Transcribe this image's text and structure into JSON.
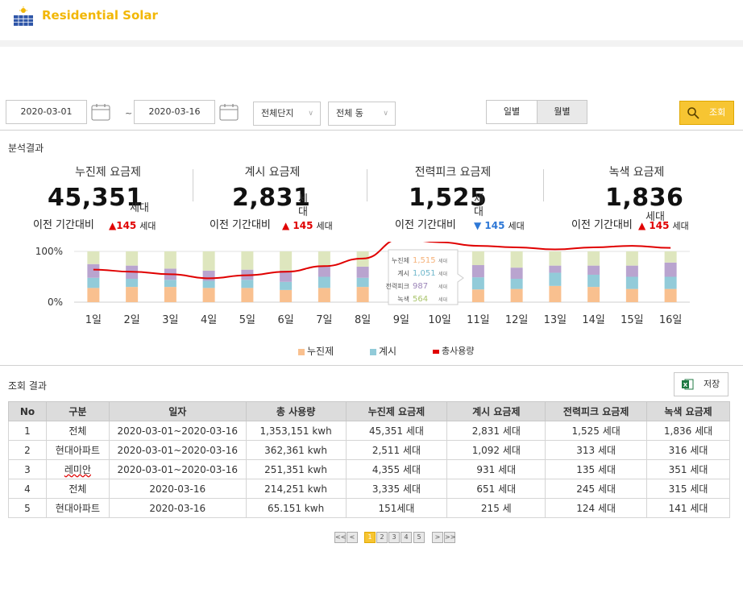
{
  "app": {
    "title": "Residential Solar"
  },
  "filters": {
    "start_date": "2020-03-01",
    "separator": "~",
    "end_date": "2020-03-16",
    "complex_select": "전체단지",
    "building_select": "전체 동",
    "period_daily": "일별",
    "period_monthly": "월별",
    "search_label": "조회"
  },
  "analysis": {
    "title": "분석결과",
    "kpis": [
      {
        "title": "누진제 요금제",
        "value": "45,351",
        "unit": "세대",
        "compare_label": "이전 기간대비",
        "delta": "145",
        "delta_unit": "세대",
        "direction": "up"
      },
      {
        "title": "계시 요금제",
        "value": "2,831",
        "unit": "세대",
        "compare_label": "이전 기간대비",
        "delta": "145",
        "delta_unit": "세대",
        "direction": "up"
      },
      {
        "title": "전력피크 요금제",
        "value": "1,525",
        "unit": "세대",
        "compare_label": "이전 기간대비",
        "delta": "145",
        "delta_unit": "세대",
        "direction": "down"
      },
      {
        "title": "녹색 요금제",
        "value": "1,836",
        "unit": "세대",
        "compare_label": "이전 기간대비",
        "delta": "145",
        "delta_unit": "세대",
        "direction": "up"
      }
    ]
  },
  "chart_data": {
    "type": "bar",
    "stacked": true,
    "categories": [
      "1일",
      "2일",
      "3일",
      "4일",
      "5일",
      "6일",
      "7일",
      "8일",
      "9일",
      "10일",
      "11일",
      "12일",
      "13일",
      "14일",
      "15일",
      "16일"
    ],
    "y_ticks": [
      "100%",
      "0%"
    ],
    "ylim": [
      0,
      100
    ],
    "series": [
      {
        "name": "누진제",
        "color": "#f9c08f",
        "values": [
          28,
          30,
          30,
          28,
          28,
          24,
          28,
          30,
          30,
          30,
          25,
          26,
          32,
          30,
          26,
          26
        ]
      },
      {
        "name": "계시",
        "color": "#92cbd9",
        "values": [
          20,
          16,
          14,
          14,
          16,
          16,
          22,
          18,
          20,
          20,
          24,
          20,
          26,
          24,
          24,
          24
        ]
      },
      {
        "name": "전력피크",
        "color": "#b9a4cf",
        "values": [
          27,
          26,
          22,
          20,
          20,
          22,
          22,
          22,
          22,
          22,
          24,
          22,
          14,
          18,
          22,
          28
        ]
      },
      {
        "name": "녹색",
        "color": "#dee6be",
        "values": [
          25,
          28,
          34,
          38,
          36,
          38,
          28,
          30,
          28,
          28,
          27,
          32,
          28,
          28,
          28,
          22
        ]
      }
    ],
    "line": {
      "name": "총사용량",
      "color": "#e00000",
      "values": [
        64,
        60,
        55,
        47,
        53,
        60,
        71,
        86,
        125,
        118,
        111,
        108,
        104,
        108,
        111,
        107
      ]
    },
    "tooltip": {
      "rows": [
        {
          "label": "누진제",
          "value": "1,515",
          "unit": "세대",
          "color": "#f5b27a"
        },
        {
          "label": "계시",
          "value": "1,051",
          "unit": "세대",
          "color": "#6fb7cc"
        },
        {
          "label": "전력피크",
          "value": "987",
          "unit": "세대",
          "color": "#9b84b8"
        },
        {
          "label": "녹색",
          "value": "564",
          "unit": "세대",
          "color": "#a9c46a"
        }
      ]
    },
    "legend": [
      "누진제",
      "계시",
      "총사용량"
    ],
    "legend_placement": "bottom"
  },
  "results": {
    "title": "조회 결과",
    "save_label": "저장",
    "columns": [
      "No",
      "구분",
      "일자",
      "총 사용량",
      "누진제 요금제",
      "계시 요금제",
      "전력피크 요금제",
      "녹색 요금제"
    ],
    "rows": [
      [
        "1",
        "전체",
        "2020-03-01~2020-03-16",
        "1,353,151 kwh",
        "45,351 세대",
        "2,831 세대",
        "1,525 세대",
        "1,836 세대"
      ],
      [
        "2",
        "현대아파트",
        "2020-03-01~2020-03-16",
        "362,361 kwh",
        "2,511 세대",
        "1,092 세대",
        "313 세대",
        "316 세대"
      ],
      [
        "3",
        "레미안",
        "2020-03-01~2020-03-16",
        "251,351 kwh",
        "4,355 세대",
        "931 세대",
        "135 세대",
        "351 세대"
      ],
      [
        "4",
        "전체",
        "2020-03-16",
        "214,251 kwh",
        "3,335 세대",
        "651 세대",
        "245 세대",
        "315 세대"
      ],
      [
        "5",
        "현대아파트",
        "2020-03-16",
        "65.151 kwh",
        "151세대",
        "215 세",
        "124 세대",
        "141 세대"
      ]
    ]
  },
  "pagination": {
    "first": "<<",
    "prev": "<",
    "pages": [
      "1",
      "2",
      "3",
      "4",
      "5"
    ],
    "current": "1",
    "next": ">",
    "last": ">>"
  }
}
